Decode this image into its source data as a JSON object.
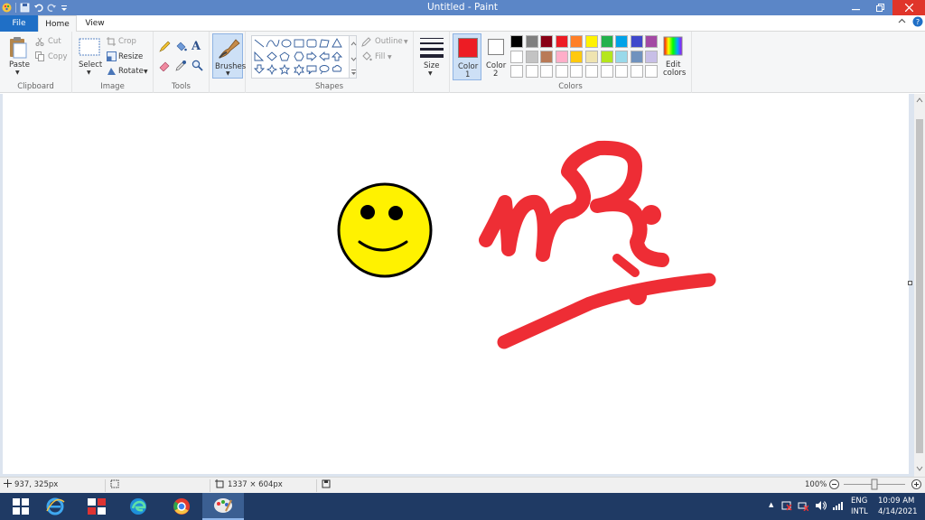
{
  "window": {
    "title": "Untitled - Paint"
  },
  "tabs": [
    {
      "label": "File"
    },
    {
      "label": "Home"
    },
    {
      "label": "View"
    }
  ],
  "ribbon": {
    "clipboard": {
      "paste": "Paste",
      "cut": "Cut",
      "copy": "Copy",
      "group_label": "Clipboard"
    },
    "image": {
      "select": "Select",
      "crop": "Crop",
      "resize": "Resize",
      "rotate": "Rotate",
      "group_label": "Image"
    },
    "tools": {
      "group_label": "Tools"
    },
    "brushes": {
      "label": "Brushes"
    },
    "shapes": {
      "outline": "Outline",
      "fill": "Fill",
      "group_label": "Shapes"
    },
    "size": {
      "label": "Size"
    },
    "colors": {
      "color1_label": "Color",
      "color1_num": "1",
      "color2_label": "Color",
      "color2_num": "2",
      "edit_label": "Edit",
      "edit_label2": "colors",
      "group_label": "Colors",
      "color1": "#ed1c24",
      "color2": "#ffffff",
      "palette_row1": [
        "#000000",
        "#7f7f7f",
        "#880015",
        "#ed1c24",
        "#ff7f27",
        "#fff200",
        "#22b14c",
        "#00a2e8",
        "#3f48cc",
        "#a349a4"
      ],
      "palette_row2": [
        "#ffffff",
        "#c3c3c3",
        "#b97a57",
        "#ffaec9",
        "#ffc90e",
        "#efe4b0",
        "#b5e61d",
        "#99d9ea",
        "#7092be",
        "#c8bfe7"
      ],
      "palette_row3": [
        "#ffffff",
        "#ffffff",
        "#ffffff",
        "#ffffff",
        "#ffffff",
        "#ffffff",
        "#ffffff",
        "#ffffff",
        "#ffffff",
        "#ffffff"
      ]
    }
  },
  "status": {
    "cursor_pos": "937, 325px",
    "canvas_size": "1337 × 604px",
    "zoom": "100%"
  },
  "taskbar": {
    "lang1": "ENG",
    "lang2": "INTL",
    "time": "10:09 AM",
    "date": "4/14/2021"
  },
  "drawing": {
    "smiley_fill": "#fff200",
    "stroke_color": "#ed1c24"
  }
}
